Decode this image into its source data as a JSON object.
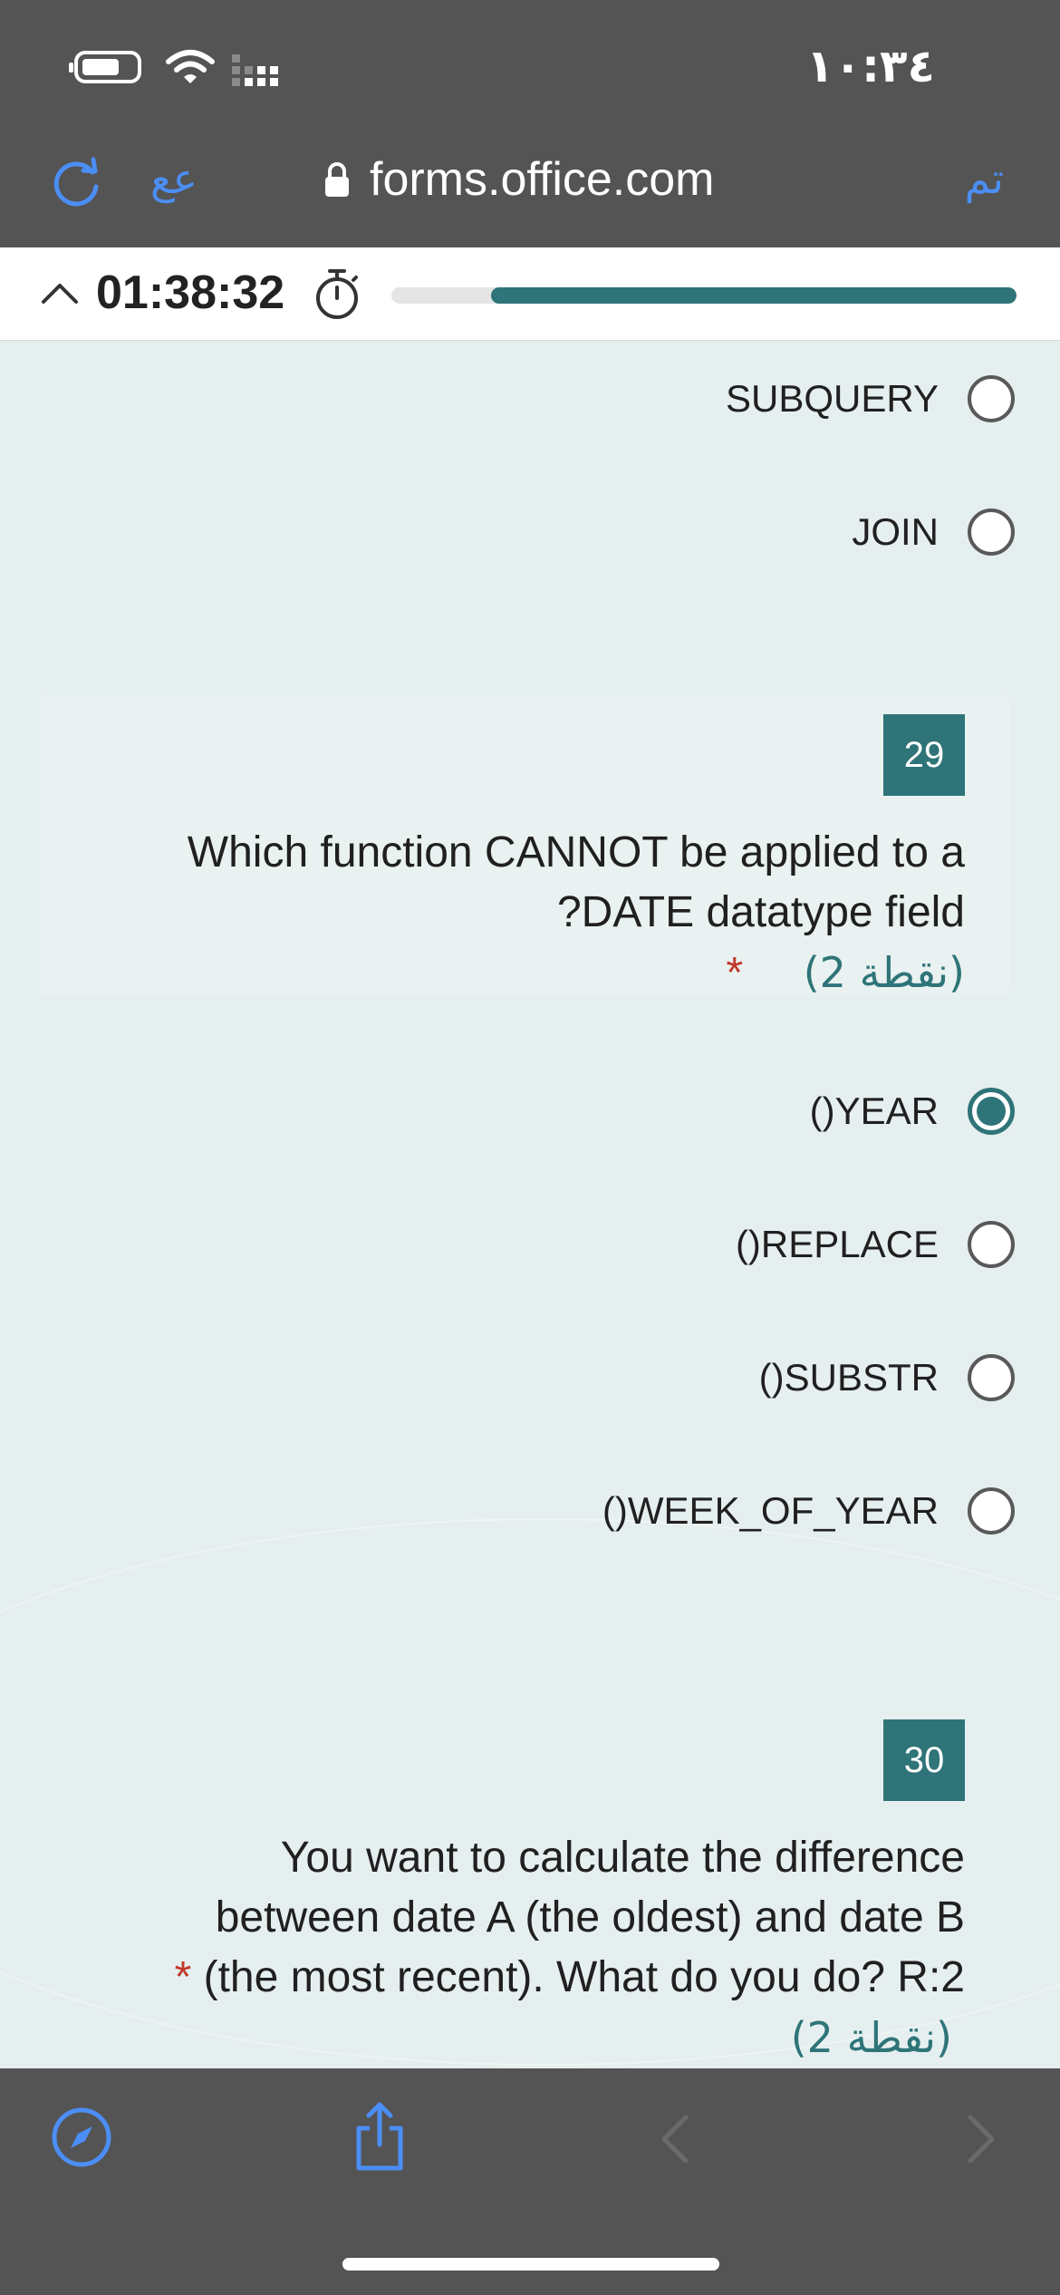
{
  "status_bar": {
    "time": "١٠:٣٤",
    "icons": [
      "battery-icon",
      "wifi-icon",
      "signal-icon"
    ]
  },
  "browser": {
    "left_label": "عع",
    "url": "forms.office.com",
    "done_label": "تم",
    "accent_color": "#4b8ef5"
  },
  "timer": {
    "time": "01:38:32",
    "progress": 0.84,
    "fill_color": "#2e7478"
  },
  "previous_question": {
    "options": [
      {
        "label": "SUBQUERY",
        "selected": false
      },
      {
        "label": "JOIN",
        "selected": false
      }
    ]
  },
  "question_29": {
    "number": "29",
    "text_line1": "Which function CANNOT be applied to a",
    "text_line2": "?DATE datatype field",
    "required": "*",
    "points": "(2 نقطة)",
    "options": [
      {
        "label": "()YEAR",
        "selected": true
      },
      {
        "label": "()REPLACE",
        "selected": false
      },
      {
        "label": "()SUBSTR",
        "selected": false
      },
      {
        "label": "()WEEK_OF_YEAR",
        "selected": false
      }
    ]
  },
  "question_30": {
    "number": "30",
    "text_line1": "You want to calculate the difference",
    "text_line2": "between date A (the oldest) and date B",
    "text_line3": "(the most recent). What do you do? R:2",
    "required": "*",
    "points": "(2 نقطة)"
  },
  "toolbar": {
    "icons": [
      "compass-icon",
      "share-icon",
      "back-icon",
      "forward-icon"
    ]
  }
}
